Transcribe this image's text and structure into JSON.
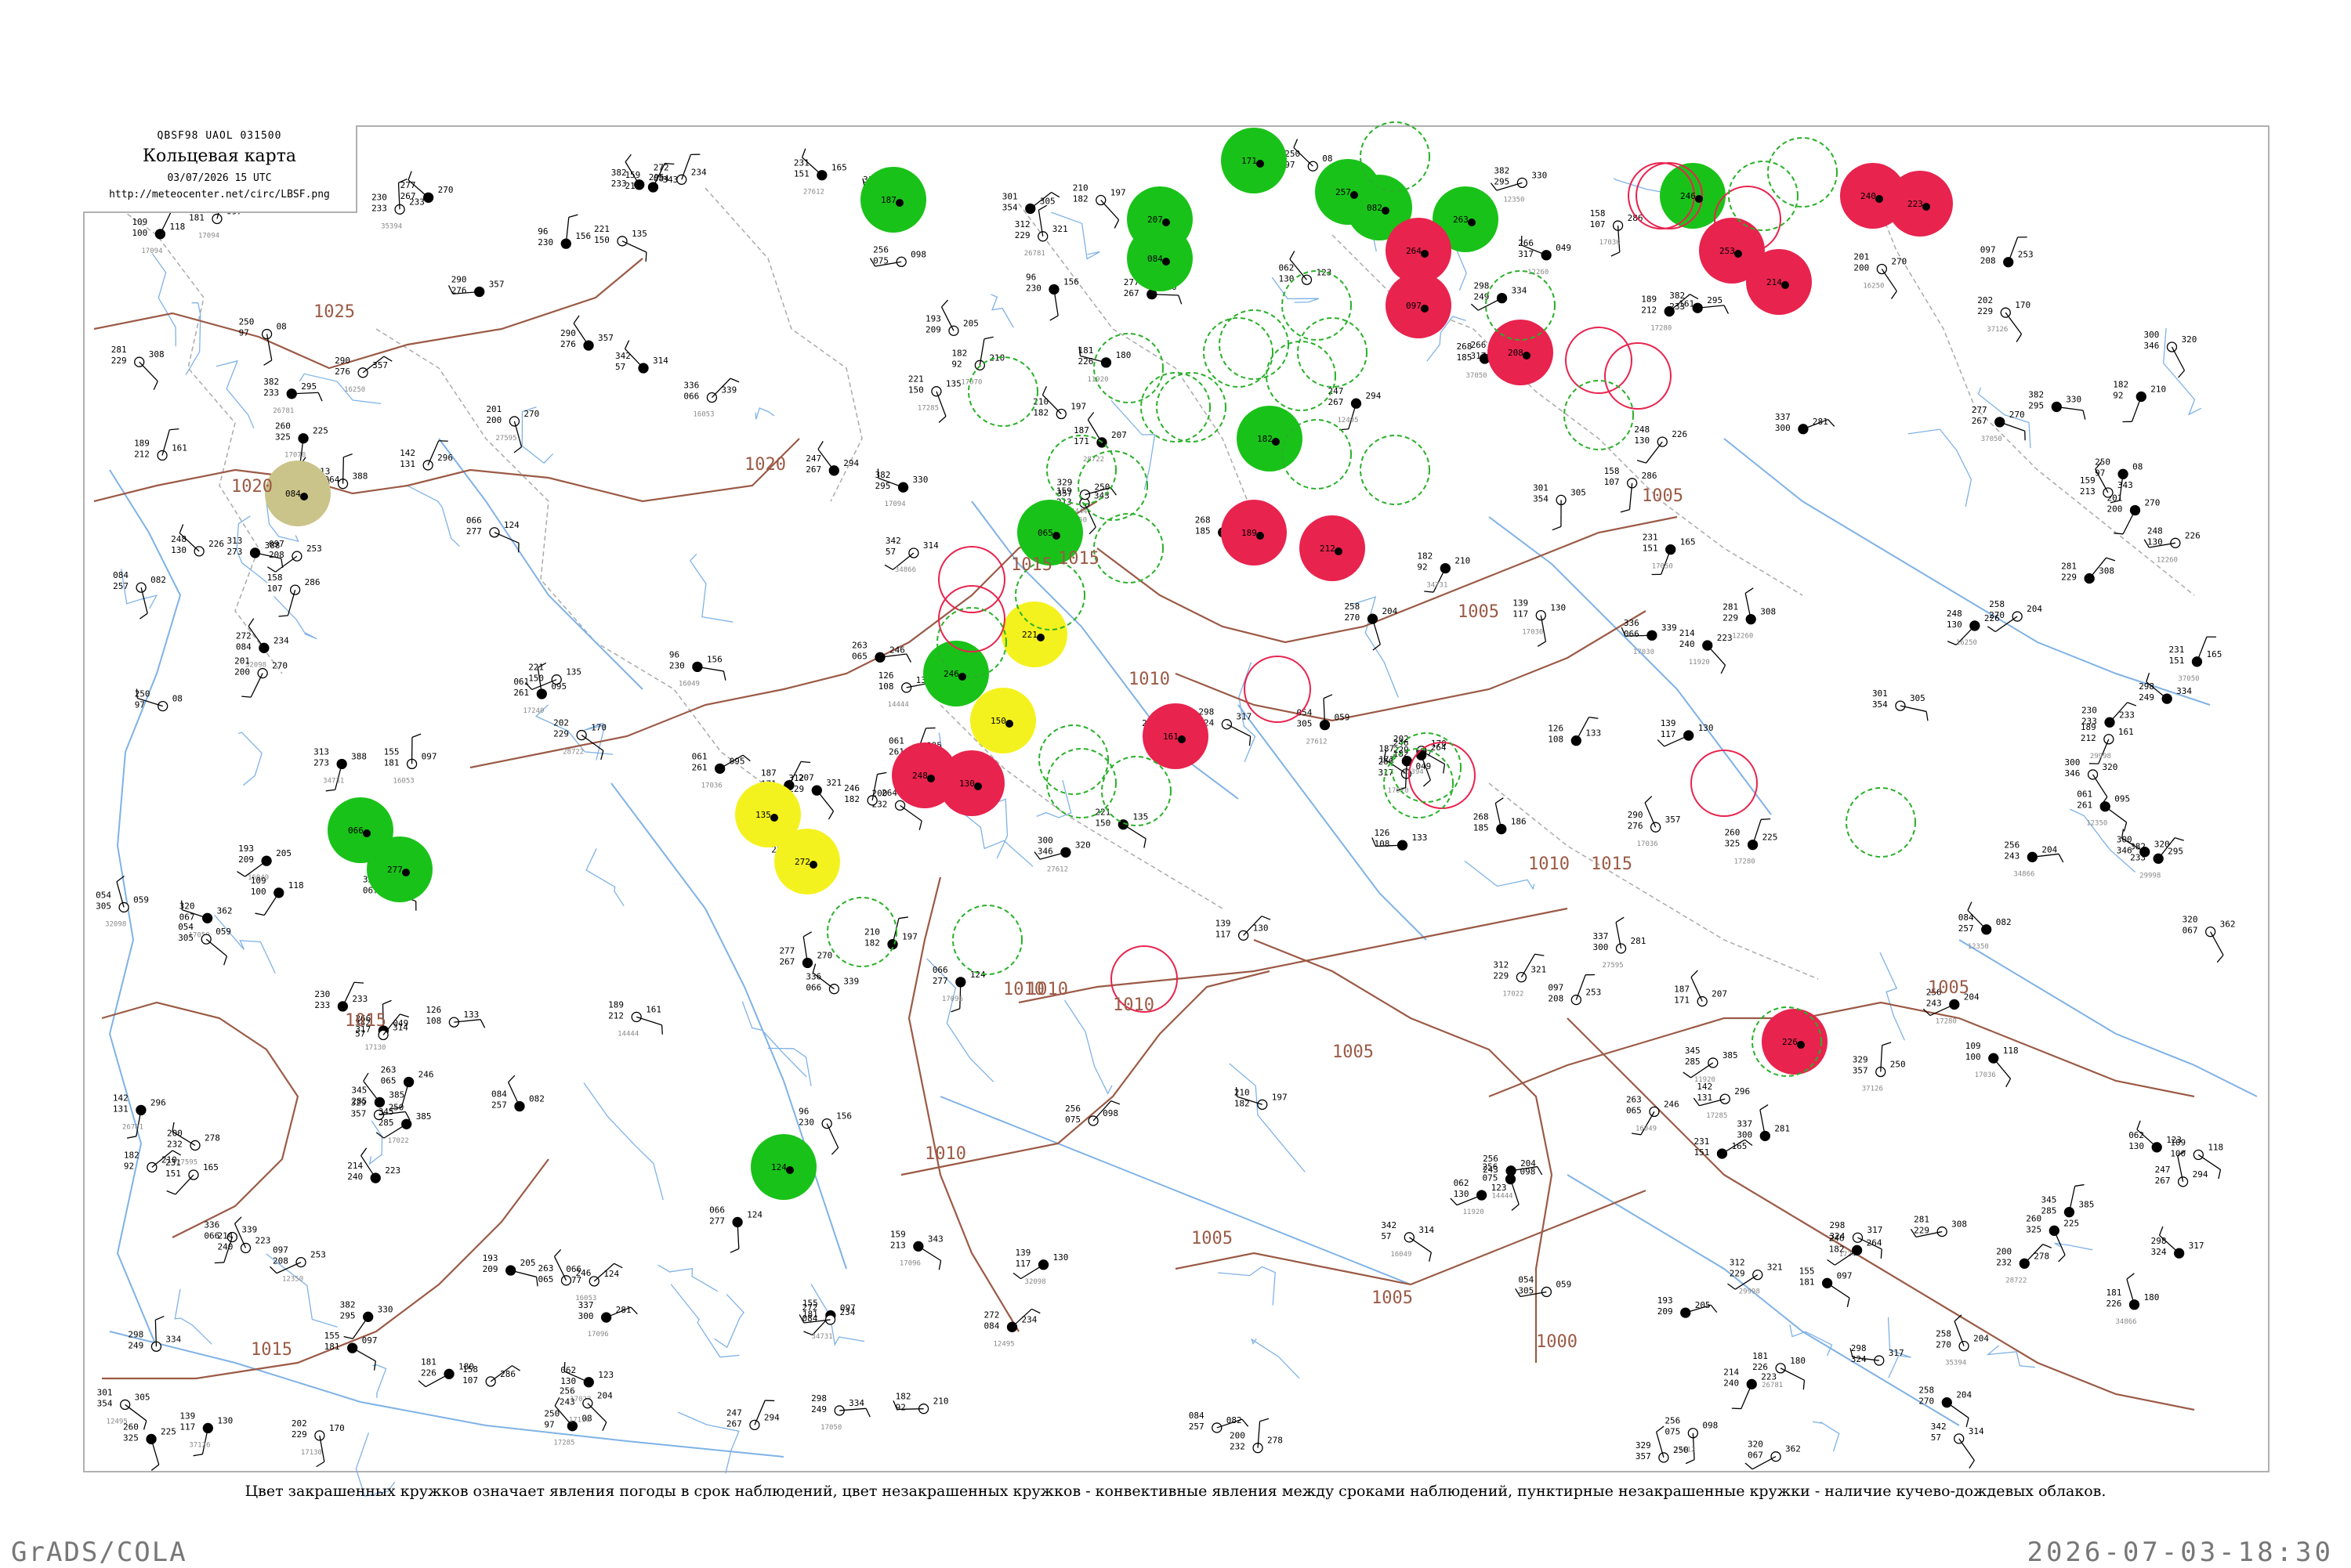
{
  "header": {
    "code": "QBSF98  UAOL  031500",
    "title": "Кольцевая карта",
    "timestamp": "03/07/2026 15 UTC",
    "url": "http://meteocenter.net/circ/LBSF.png"
  },
  "caption": "Цвет закрашенных кружков означает явления погоды в срок наблюдений, цвет незакрашенных кружков - конвективные явления между сроками наблюдений, пунктирные незакрашенные кружки - наличие кучево-дождевых облаков.",
  "footer": {
    "left": "GrADS/COLA",
    "right": "2026-07-03-18:30"
  },
  "colors": {
    "green": "#19c219",
    "red": "#e8234e",
    "yellow": "#f4f21e",
    "olive": "#cbc48a",
    "isobar": "#9b5a46",
    "river": "#7fb2e6",
    "border": "#aaaaaa"
  },
  "isobar_labels": [
    "1025",
    "1020",
    "1020",
    "1015",
    "1015",
    "1015",
    "1015",
    "1015",
    "1010",
    "1010",
    "1010",
    "1010",
    "1010",
    "1010",
    "1005",
    "1005",
    "1005",
    "1005",
    "1005",
    "1005",
    "1000"
  ],
  "station_values": [
    "250",
    "97",
    "08",
    "182",
    "92",
    "210",
    "342",
    "57",
    "314",
    "231",
    "151",
    "165",
    "139",
    "117",
    "130",
    "155",
    "181",
    "097",
    "187",
    "171",
    "207",
    "084",
    "257",
    "082",
    "263",
    "065",
    "246",
    "066",
    "277",
    "124",
    "246",
    "182",
    "264",
    "097",
    "208",
    "253",
    "214",
    "240",
    "223",
    "189",
    "212",
    "161",
    "248",
    "130",
    "226",
    "221",
    "150",
    "135",
    "272",
    "084",
    "234",
    "181",
    "226",
    "180",
    "256",
    "075",
    "098",
    "158",
    "107",
    "286",
    "268",
    "185",
    "186",
    "210",
    "182",
    "197",
    "201",
    "200",
    "270",
    "202",
    "229",
    "170",
    "193",
    "209",
    "205",
    "230",
    "233",
    "233",
    "312",
    "229",
    "321",
    "054",
    "305",
    "059",
    "336",
    "066",
    "339",
    "061",
    "261",
    "095",
    "200",
    "232",
    "278",
    "266",
    "317",
    "049",
    "320",
    "067",
    "362",
    "062",
    "130",
    "123",
    "126",
    "108",
    "133",
    "109",
    "100",
    "118",
    "96",
    "230",
    "156",
    "159",
    "213",
    "343",
    "247",
    "267",
    "294",
    "260",
    "325",
    "225",
    "142",
    "131",
    "296",
    "298",
    "249",
    "334",
    "300",
    "346",
    "320",
    "382",
    "295",
    "330",
    "313",
    "273",
    "388",
    "298",
    "324",
    "317",
    "281",
    "229",
    "308",
    "337",
    "300",
    "281",
    "256",
    "243",
    "204",
    "277",
    "267",
    "270",
    "345",
    "285",
    "385",
    "329",
    "357",
    "250",
    "258",
    "270",
    "204",
    "290",
    "276",
    "357",
    "301",
    "354",
    "305",
    "382",
    "233",
    "295"
  ],
  "map_labels": [
    "16049",
    "16053",
    "12350",
    "12260",
    "11920",
    "14444",
    "16250",
    "12495",
    "26781",
    "27612",
    "17030",
    "17240",
    "27595",
    "17130",
    "17022",
    "17036",
    "17070",
    "17050",
    "17094",
    "17096",
    "17280",
    "17285",
    "34731",
    "34866",
    "37050",
    "37126",
    "35394",
    "29998",
    "32098",
    "28722"
  ]
}
